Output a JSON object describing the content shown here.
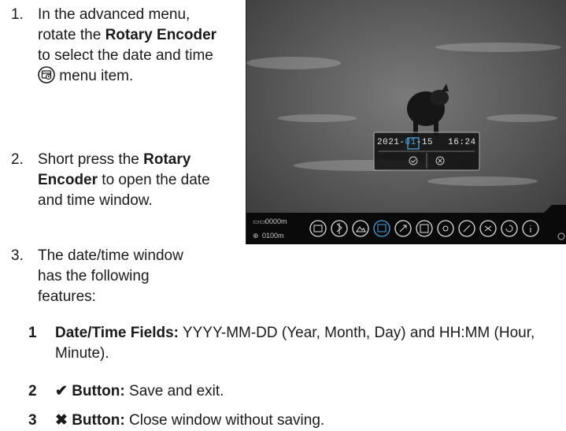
{
  "steps": [
    {
      "number": "1.",
      "parts": [
        "In the advanced menu, rotate the ",
        "Rotary Encoder",
        " to select the date and time ",
        " menu item."
      ]
    },
    {
      "number": "2.",
      "parts": [
        "Short press the ",
        "Rotary Encoder",
        " to open the date and time window."
      ]
    },
    {
      "number": "3.",
      "parts": [
        "The date/time window has the following features:"
      ]
    }
  ],
  "screen": {
    "date_prefix": "2021-",
    "date_highlight": "01",
    "date_suffix": "-15",
    "time": "16:24",
    "distance_top": "0000m",
    "distance_bottom": "0100m",
    "menu_icons": [
      "grid-icon",
      "bluetooth-icon",
      "image-icon",
      "datetime-icon",
      "compass-icon",
      "picture-in-picture-icon",
      "brightness-icon",
      "unit-icon",
      "calibration-icon",
      "reset-icon",
      "info-icon"
    ]
  },
  "features": [
    {
      "num": "1",
      "title": "Date/Time Fields:",
      "desc": "YYYY-MM-DD (Year, Month, Day) and HH:MM (Hour, Minute)."
    },
    {
      "num": "2",
      "title": "✔ Button:",
      "desc": "Save and exit."
    },
    {
      "num": "3",
      "title": "✖ Button:",
      "desc": "Close window without saving."
    }
  ]
}
